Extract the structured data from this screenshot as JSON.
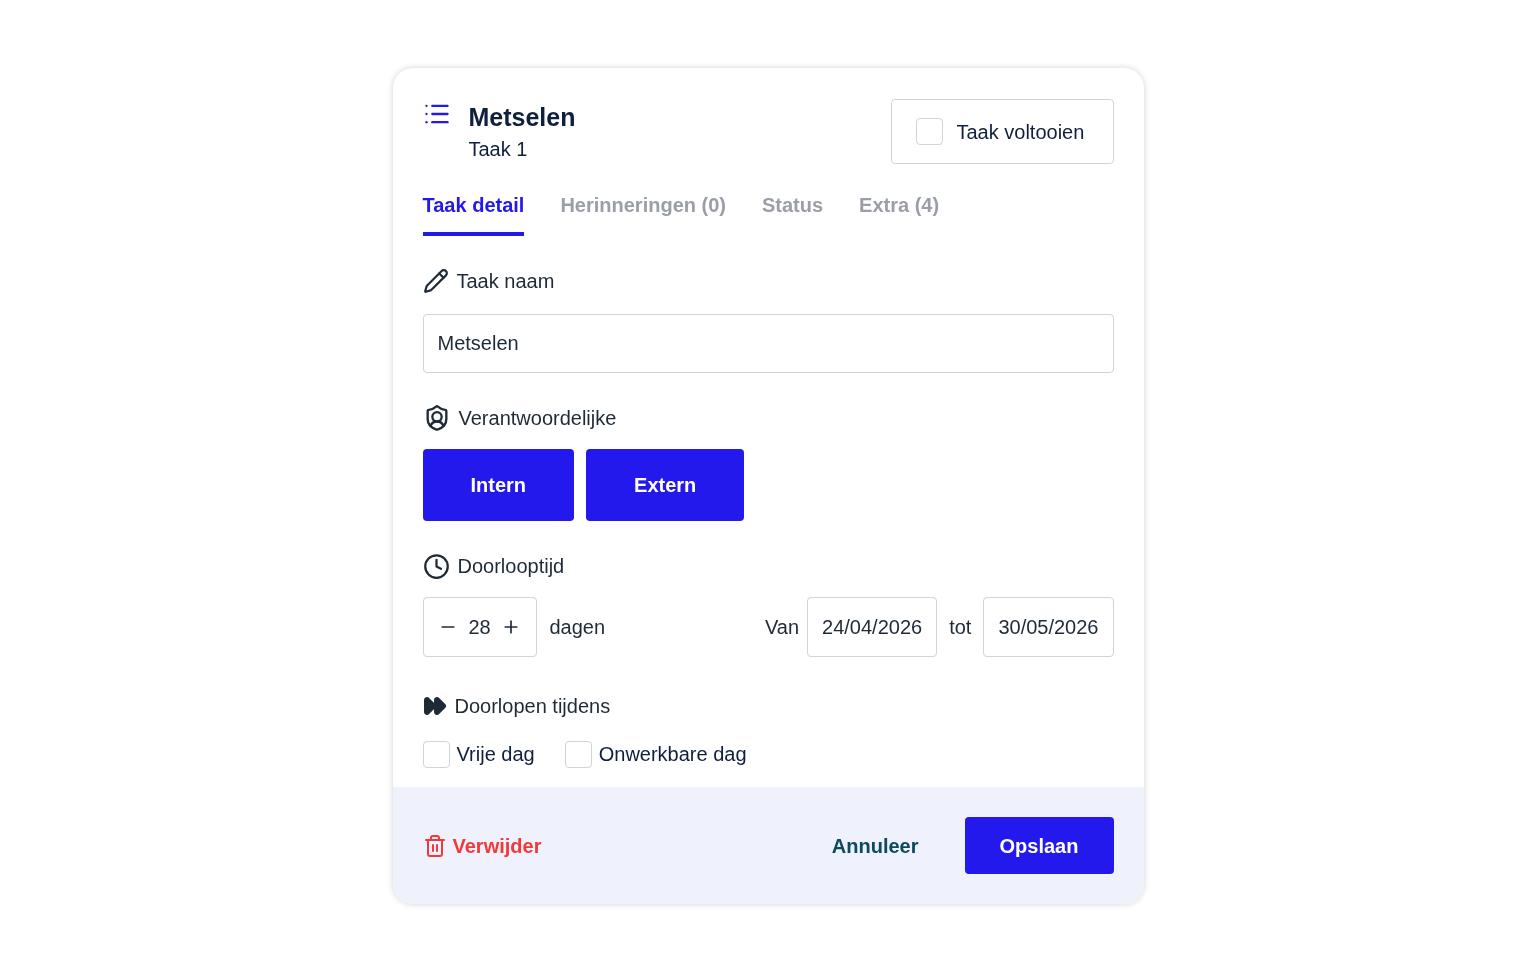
{
  "header": {
    "title": "Metselen",
    "subtitle": "Taak 1",
    "complete": {
      "label": "Taak voltooien",
      "checked": false
    }
  },
  "tabs": [
    {
      "label": "Taak detail",
      "selected": true
    },
    {
      "label": "Herinneringen (0)",
      "selected": false
    },
    {
      "label": "Status",
      "selected": false
    },
    {
      "label": "Extra (4)",
      "selected": false
    }
  ],
  "name_field": {
    "label": "Taak naam",
    "value": "Metselen"
  },
  "responsible": {
    "label": "Verantwoordelijke",
    "options": [
      "Intern",
      "Extern"
    ]
  },
  "duration": {
    "label": "Doorlooptijd",
    "value": "28",
    "unit": "dagen",
    "from_label": "Van",
    "from": "24/04/2026",
    "to_label": "tot",
    "to": "30/05/2026"
  },
  "continue_during": {
    "label": "Doorlopen tijdens",
    "options": [
      {
        "label": "Vrije dag",
        "checked": false
      },
      {
        "label": "Onwerkbare dag",
        "checked": false
      }
    ]
  },
  "footer": {
    "delete": "Verwijder",
    "cancel": "Annuleer",
    "save": "Opslaan"
  }
}
